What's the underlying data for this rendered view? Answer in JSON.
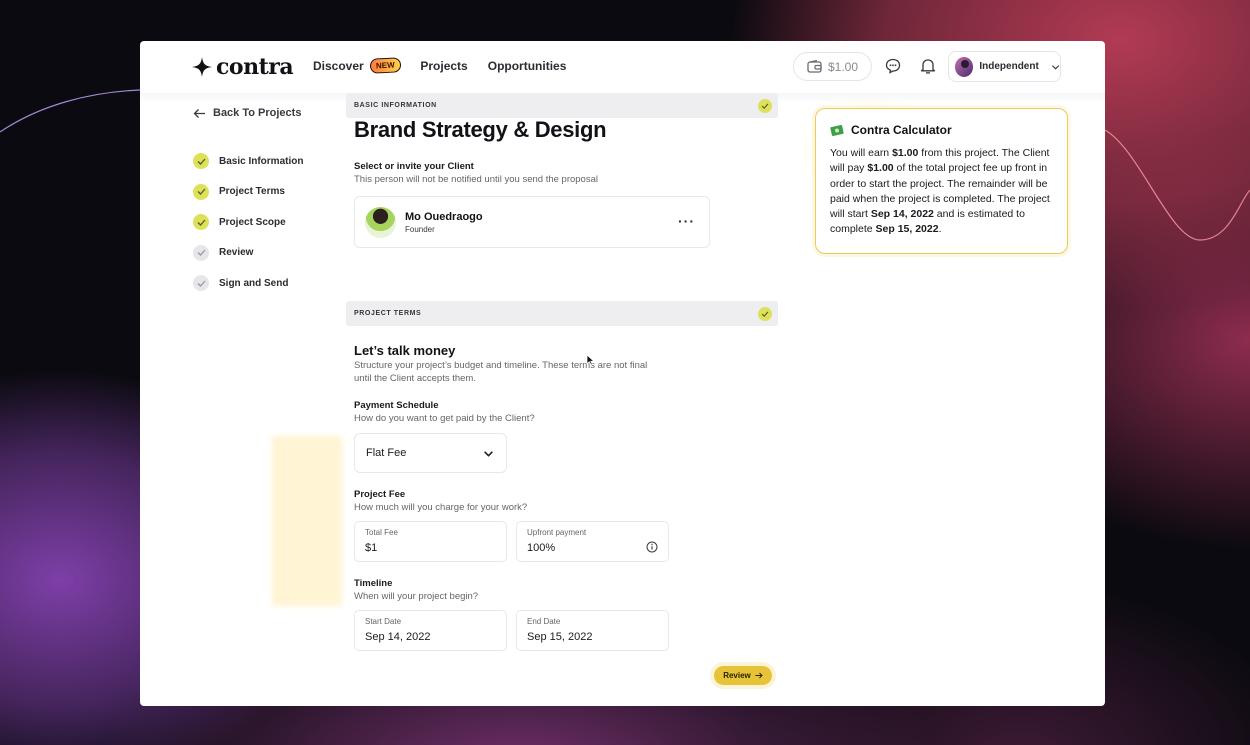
{
  "brand": {
    "name": "contra"
  },
  "nav": {
    "discover": "Discover",
    "discover_badge": "NEW",
    "projects": "Projects",
    "opportunities": "Opportunities"
  },
  "header": {
    "wallet_amount": "$1.00",
    "account_name": "Independent"
  },
  "sidebar": {
    "back_label": "Back To Projects",
    "steps": [
      {
        "label": "Basic Information",
        "state": "done"
      },
      {
        "label": "Project Terms",
        "state": "done"
      },
      {
        "label": "Project Scope",
        "state": "done"
      },
      {
        "label": "Review",
        "state": "todo"
      },
      {
        "label": "Sign and Send",
        "state": "todo"
      }
    ]
  },
  "basic": {
    "section_label": "BASIC INFORMATION",
    "title": "Brand Strategy & Design",
    "client_label": "Select or invite your Client",
    "client_sub": "This person will not be notified until you send the proposal",
    "client_name": "Mo Ouedraogo",
    "client_role": "Founder"
  },
  "terms": {
    "section_label": "PROJECT TERMS",
    "heading": "Let’s talk money",
    "intro_line1": "Structure your project’s budget and timeline. These terms are not final",
    "intro_line2": "until the Client accepts them.",
    "payment_label": "Payment Schedule",
    "payment_sub": "How do you want to get paid by the Client?",
    "payment_value": "Flat Fee",
    "fee_label": "Project Fee",
    "fee_sub": "How much will you charge for your work?",
    "total_fee_label": "Total Fee",
    "total_fee_value": "$1",
    "upfront_label": "Upfront payment",
    "upfront_value": "100%",
    "timeline_label": "Timeline",
    "timeline_sub": "When will your project begin?",
    "start_label": "Start Date",
    "start_value": "Sep 14, 2022",
    "end_label": "End Date",
    "end_value": "Sep 15, 2022",
    "review_button": "Review"
  },
  "calculator": {
    "title": "Contra Calculator",
    "t1": "You will earn ",
    "earn": "$1.00",
    "t2": " from this project. The Client will pay ",
    "pay": "$1.00",
    "t3": " of the total project fee up front in order to start the project. The remainder will be paid when the project is completed. The project will start ",
    "start": "Sep 14, 2022",
    "t4": " and is estimated to complete ",
    "end": "Sep 15, 2022",
    "t5": "."
  },
  "colors": {
    "accent_yellow": "#dde15a",
    "button_yellow": "#e7c33a",
    "calc_border": "#eccb5a"
  }
}
